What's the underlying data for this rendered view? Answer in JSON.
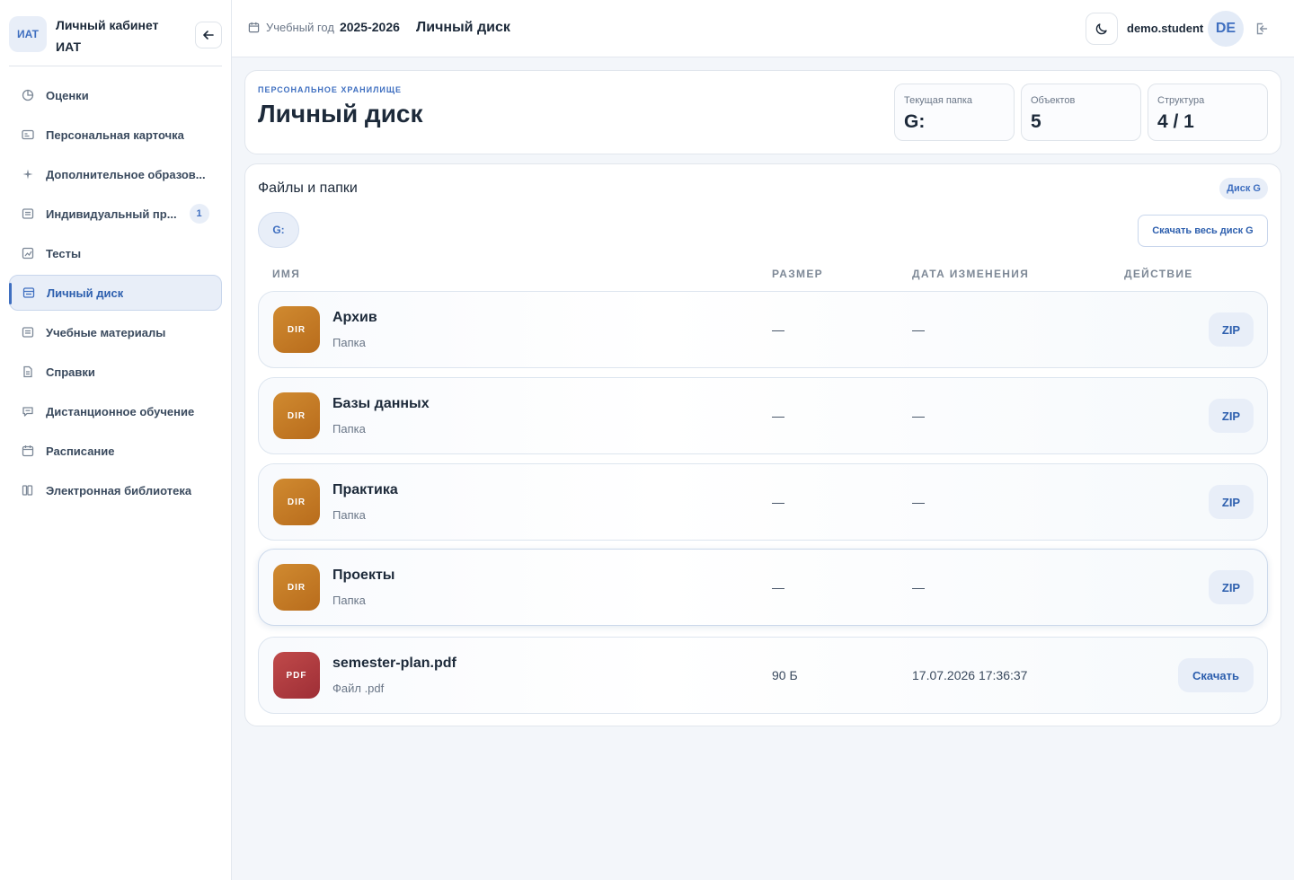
{
  "sidebar": {
    "brand_badge": "ИАТ",
    "brand_title": "Личный кабинет ИАТ",
    "items": [
      {
        "label": "Оценки",
        "icon": "pie-chart-icon"
      },
      {
        "label": "Персональная карточка",
        "icon": "id-card-icon"
      },
      {
        "label": "Дополнительное образов...",
        "icon": "sparkle-icon"
      },
      {
        "label": "Индивидуальный пр...",
        "icon": "document-icon",
        "badge": "1"
      },
      {
        "label": "Тесты",
        "icon": "chart-icon"
      },
      {
        "label": "Личный диск",
        "icon": "disk-icon",
        "active": true
      },
      {
        "label": "Учебные материалы",
        "icon": "document-icon"
      },
      {
        "label": "Справки",
        "icon": "file-icon"
      },
      {
        "label": "Дистанционное обучение",
        "icon": "chat-icon"
      },
      {
        "label": "Расписание",
        "icon": "calendar-icon"
      },
      {
        "label": "Электронная библиотека",
        "icon": "book-icon"
      }
    ]
  },
  "header": {
    "year_label": "Учебный год",
    "year_value": "2025-2026",
    "page_title": "Личный диск",
    "username": "demo.student",
    "avatar_initials": "DE"
  },
  "hero": {
    "eyebrow": "ПЕРСОНАЛЬНОЕ ХРАНИЛИЩЕ",
    "title": "Личный диск",
    "stats": [
      {
        "label": "Текущая папка",
        "value": "G:"
      },
      {
        "label": "Объектов",
        "value": "5"
      },
      {
        "label": "Структура",
        "value": "4 / 1"
      }
    ]
  },
  "files": {
    "title": "Файлы и папки",
    "disk_pill": "Диск G",
    "breadcrumb": "G:",
    "download_all": "Скачать весь диск G",
    "columns": [
      "ИМЯ",
      "РАЗМЕР",
      "ДАТА ИЗМЕНЕНИЯ",
      "ДЕЙСТВИЕ"
    ],
    "rows": [
      {
        "badge": "DIR",
        "name": "Архив",
        "type": "Папка",
        "size": "—",
        "date": "—",
        "action": "ZIP"
      },
      {
        "badge": "DIR",
        "name": "Базы данных",
        "type": "Папка",
        "size": "—",
        "date": "—",
        "action": "ZIP"
      },
      {
        "badge": "DIR",
        "name": "Практика",
        "type": "Папка",
        "size": "—",
        "date": "—",
        "action": "ZIP"
      },
      {
        "badge": "DIR",
        "name": "Проекты",
        "type": "Папка",
        "size": "—",
        "date": "—",
        "action": "ZIP"
      },
      {
        "badge": "PDF",
        "name": "semester-plan.pdf",
        "type": "Файл .pdf",
        "size": "90 Б",
        "date": "17.07.2026 17:36:37",
        "action": "Скачать"
      }
    ]
  }
}
